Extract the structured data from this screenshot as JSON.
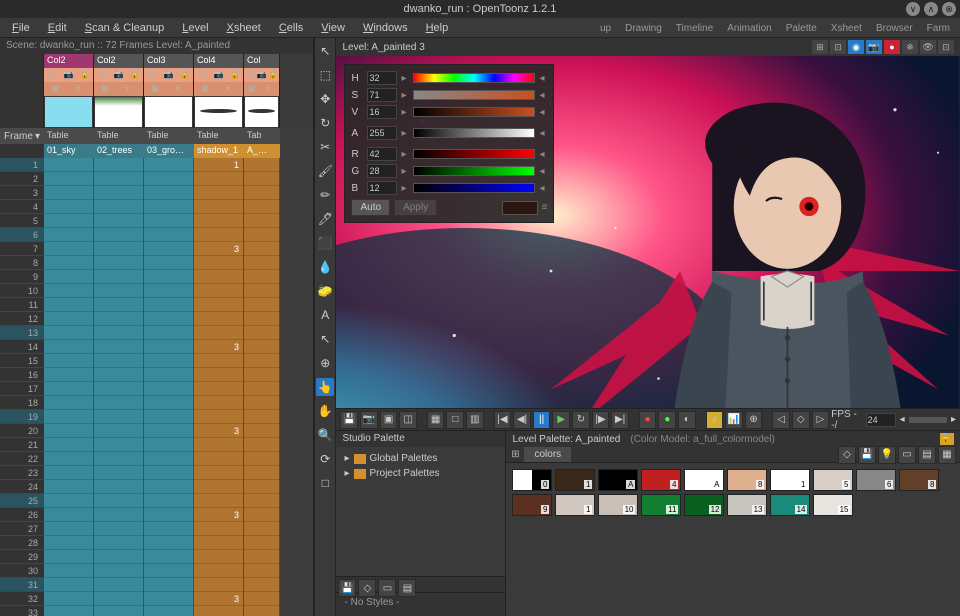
{
  "title": "dwanko_run : OpenToonz 1.2.1",
  "menubar": [
    "File",
    "Edit",
    "Scan & Cleanup",
    "Level",
    "Xsheet",
    "Cells",
    "View",
    "Windows",
    "Help"
  ],
  "top_right_tabs": [
    "up",
    "Drawing",
    "Timeline",
    "Animation",
    "Palette",
    "Xsheet",
    "Browser",
    "Farm"
  ],
  "scene_info": "Scene: dwanko_run  ::  72 Frames  Level: A_painted",
  "frame_label": "Frame",
  "columns": [
    {
      "name": "Col2",
      "table": "Table",
      "cell": "01_sky",
      "thumb": "sky"
    },
    {
      "name": "Col2",
      "table": "Table",
      "cell": "02_trees",
      "thumb": "trees"
    },
    {
      "name": "Col3",
      "table": "Table",
      "cell": "03_gro…",
      "thumb": "grow"
    },
    {
      "name": "Col4",
      "table": "Table",
      "cell": "shadow_1",
      "thumb": "shadow",
      "orange": true
    },
    {
      "name": "Col",
      "table": "Tab",
      "cell": "A_…",
      "thumb": "shadow",
      "orange": true
    }
  ],
  "frames": 33,
  "key_frames": [
    1,
    6,
    13,
    19,
    25,
    31
  ],
  "cell_marks": {
    "3": [
      7,
      14,
      20,
      26,
      32
    ]
  },
  "viewer_label": "Level: A_painted 3",
  "hsv": {
    "H": "32",
    "S": "71",
    "V": "16",
    "A": "255",
    "R": "42",
    "G": "28",
    "B": "12",
    "auto": "Auto",
    "apply": "Apply"
  },
  "fps_label": "FPS --/",
  "fps_value": "24",
  "studio_palette": {
    "title": "Studio Palette",
    "items": [
      "Global Palettes",
      "Project Palettes"
    ],
    "nostyles": "- No Styles -"
  },
  "level_palette": {
    "title": "Level Palette: A_painted",
    "color_model": "(Color Model: a_full_colormodel)",
    "tab": "colors",
    "swatches": [
      {
        "n": "0",
        "c": "split"
      },
      {
        "n": "1",
        "c": "#3a2818"
      },
      {
        "n": "A",
        "c": "#000000"
      },
      {
        "n": "4",
        "c": "#c02020"
      },
      {
        "n": "A",
        "c": "#ffffff"
      },
      {
        "n": "8",
        "c": "#e0b090"
      },
      {
        "n": "1",
        "c": "#ffffff"
      },
      {
        "n": "5",
        "c": "#d8d0c8"
      },
      {
        "n": "6",
        "c": "#888888"
      },
      {
        "n": "8",
        "c": "#604028"
      },
      {
        "n": "9",
        "c": "#5a3020"
      },
      {
        "n": "1",
        "c": "#d0c8c0"
      },
      {
        "n": "10",
        "c": "#c8c0b8"
      },
      {
        "n": "11",
        "c": "#108030"
      },
      {
        "n": "12",
        "c": "#0a6020"
      },
      {
        "n": "13",
        "c": "#c8c4c0"
      },
      {
        "n": "14",
        "c": "#1a8a7a"
      },
      {
        "n": "15",
        "c": "#e8e4e0"
      }
    ]
  },
  "tools": [
    "↖",
    "⬚",
    "✥",
    "↻",
    "✂",
    "🖌",
    "✏",
    "🖊",
    "⬛",
    "💧",
    "🧽",
    "A",
    "↖",
    "⊕",
    "👆",
    "✋",
    "🔍",
    "⟳",
    "□"
  ]
}
